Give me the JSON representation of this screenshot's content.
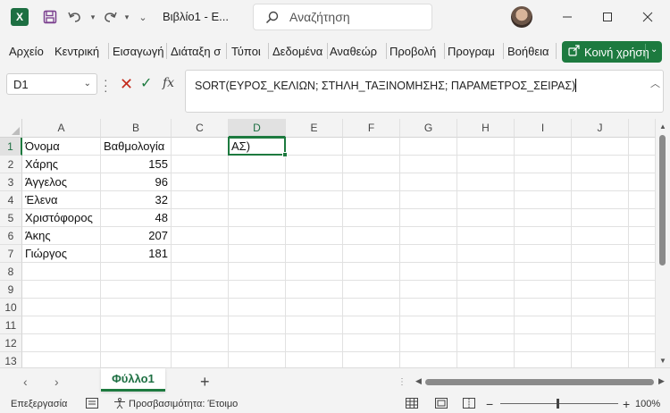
{
  "app": {
    "logo_letter": "X",
    "doc_title": "Βιβλίο1 -  Ε..."
  },
  "search": {
    "placeholder": "Αναζήτηση"
  },
  "ribbon": {
    "tabs": [
      "Αρχείο",
      "Κεντρική",
      "Εισαγωγή",
      "Διάταξη σ",
      "Τύποι",
      "Δεδομένα",
      "Αναθεώρ",
      "Προβολή",
      "Προγραμ",
      "Βοήθεια"
    ],
    "share_label": "Κοινή χρήση"
  },
  "formula_bar": {
    "name_box": "D1",
    "formula": "SORT(ΕΥΡΟΣ_ΚΕΛΙΩΝ; ΣΤΗΛΗ_ΤΑΞΙΝΟΜΗΣΗΣ; ΠΑΡΑΜΕΤΡΟΣ_ΣΕΙΡΑΣ)"
  },
  "grid": {
    "columns": [
      "A",
      "B",
      "C",
      "D",
      "E",
      "F",
      "G",
      "H",
      "I",
      "J"
    ],
    "rows": [
      "1",
      "2",
      "3",
      "4",
      "5",
      "6",
      "7",
      "8",
      "9",
      "10",
      "11",
      "12",
      "13"
    ],
    "selected_column": "D",
    "selected_row": "1",
    "cells": {
      "A1": "Όνομα",
      "B1": "Βαθμολογία",
      "D1": "ΑΣ)",
      "A2": "Χάρης",
      "B2": "155",
      "A3": "Άγγελος",
      "B3": "96",
      "A4": "Έλενα",
      "B4": "32",
      "A5": "Χριστόφορος",
      "B5": "48",
      "A6": "Άκης",
      "B6": "207",
      "A7": "Γιώργος",
      "B7": "181"
    }
  },
  "sheets": {
    "active_tab": "Φύλλο1"
  },
  "status": {
    "mode": "Επεξεργασία",
    "accessibility": "Προσβασιμότητα: Έτοιμο",
    "zoom": "100%"
  },
  "colors": {
    "accent": "#1d7a3f",
    "excel_green": "#1d6f42",
    "cancel_red": "#c42b1c"
  }
}
